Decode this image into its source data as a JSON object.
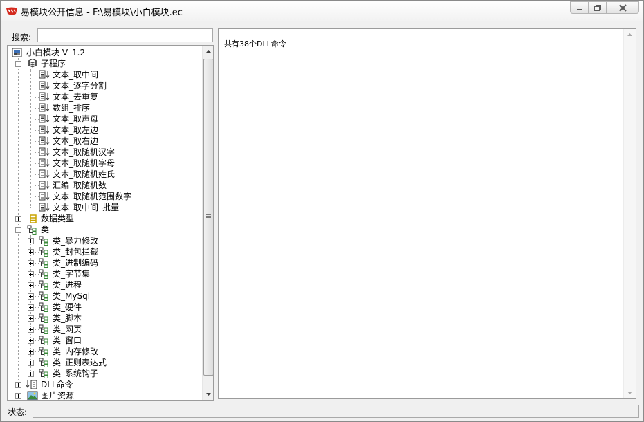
{
  "window": {
    "title": "易模块公开信息 - F:\\易模块\\小白模块.ec"
  },
  "search": {
    "label": "搜索:",
    "value": "",
    "placeholder": ""
  },
  "tree": {
    "root": {
      "label": "小白模块 V_1.2",
      "icon": "module-icon"
    },
    "subprograms": {
      "label": "子程序",
      "icon": "books-icon",
      "expanded": true,
      "items": [
        "文本_取中间",
        "文本_逐字分割",
        "文本_去重复",
        "数组_排序",
        "文本_取声母",
        "文本_取左边",
        "文本_取右边",
        "文本_取随机汉字",
        "文本_取随机字母",
        "文本_取随机姓氏",
        "汇编_取随机数",
        "文本_取随机范围数字",
        "文本_取中间_批量"
      ]
    },
    "datatypes": {
      "label": "数据类型",
      "icon": "datatype-icon",
      "expanded": false
    },
    "classes": {
      "label": "类",
      "icon": "class-icon",
      "expanded": true,
      "items": [
        "类_暴力修改",
        "类_封包拦截",
        "类_进制编码",
        "类_字节集",
        "类_进程",
        "类_MySql",
        "类_硬件",
        "类_脚本",
        "类_网页",
        "类_窗口",
        "类_内存修改",
        "类_正则表达式",
        "类_系统钩子"
      ]
    },
    "dll": {
      "label": "DLL命令",
      "icon": "dll-icon",
      "expanded": false
    },
    "images": {
      "label": "图片资源",
      "icon": "image-icon",
      "expanded": false
    }
  },
  "content": {
    "text": "共有38个DLL命令"
  },
  "status": {
    "label": "状态:",
    "value": ""
  },
  "colors": {
    "title_icon_red": "#d42a1e",
    "tree_line": "#a0a0a0",
    "class_icon_green": "#3a8a3a",
    "folder_yellow": "#c9a400"
  }
}
